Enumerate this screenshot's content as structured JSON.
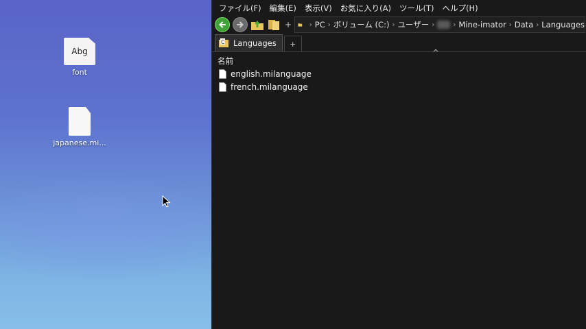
{
  "desktop": {
    "icons": [
      {
        "label": "font",
        "glyph_text": "Abg",
        "icon": "font-file-icon"
      },
      {
        "label": "japanese.mi...",
        "icon": "blank-file-icon"
      }
    ]
  },
  "explorer": {
    "menu": [
      "ファイル(F)",
      "編集(E)",
      "表示(V)",
      "お気に入り(A)",
      "ツール(T)",
      "ヘルプ(H)"
    ],
    "toolbar": {
      "back_icon": "back-arrow-icon",
      "forward_icon": "forward-arrow-icon",
      "up_icon": "up-folder-icon",
      "folders_icon": "folders-icon",
      "plus": "+"
    },
    "breadcrumb": [
      "PC",
      "ボリューム (C:)",
      "ユーザー",
      "",
      "Mine-imator",
      "Data",
      "Languages"
    ],
    "tabs": [
      {
        "label": "Languages"
      }
    ],
    "tab_add": "+",
    "column_header": "名前",
    "sort_caret": "^",
    "files": [
      {
        "name": "english.milanguage"
      },
      {
        "name": "french.milanguage"
      }
    ]
  },
  "colors": {
    "explorer_bg": "#191919",
    "desktop_top": "#5a63c8",
    "desktop_bottom": "#86bfe8",
    "back_button": "#3fa33a"
  }
}
